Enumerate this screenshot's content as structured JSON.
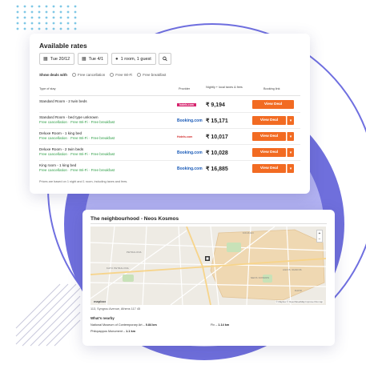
{
  "colors": {
    "accent": "#f26b22",
    "perk": "#2e9e46",
    "booking_blue": "#1a5bb8",
    "hotels_red": "#d32f2f",
    "decor_purple": "#6f6fe0"
  },
  "rates": {
    "title": "Available rates",
    "controls": [
      {
        "icon": "calendar-icon",
        "label": "Tue 20/12"
      },
      {
        "icon": "calendar-icon",
        "label": "Tue 4/1"
      },
      {
        "icon": "person-icon",
        "label": "1 room, 1 guest"
      },
      {
        "icon": "search-icon",
        "label": ""
      }
    ],
    "filters": {
      "label": "Show deals with",
      "options": [
        "Free cancellation",
        "Free Wi-Fi",
        "Free breakfast"
      ]
    },
    "columns": [
      "Type of stay",
      "Provider",
      "Nightly + local taxes & fees",
      "Booking link"
    ],
    "rows": [
      {
        "room": "Standard Room - 2 twin beds",
        "perks": "",
        "provider": "hotels.com",
        "price": "₹ 9,194",
        "deal": "View Deal",
        "dropdown": false
      },
      {
        "room": "Standard Room - bed type unknown",
        "perks": "Free cancellation · Free Wi-Fi · Free breakfast",
        "provider": "Booking.com",
        "price": "₹ 15,171",
        "deal": "View Deal",
        "dropdown": true
      },
      {
        "room": "Deluxe Room - 1 king bed",
        "perks": "Free cancellation · Free Wi-Fi · Free breakfast",
        "provider": "Hotels.com",
        "price": "₹ 10,017",
        "deal": "View Deal",
        "dropdown": true
      },
      {
        "room": "Deluxe Room - 2 twin beds",
        "perks": "Free cancellation · Free Wi-Fi · Free breakfast",
        "provider": "Booking.com",
        "price": "₹ 10,028",
        "deal": "View Deal",
        "dropdown": true
      },
      {
        "room": "King room - 1 king bed",
        "perks": "Free cancellation · Free Wi-Fi · Free breakfast",
        "provider": "Booking.com",
        "price": "₹ 16,885",
        "deal": "View Deal",
        "dropdown": true
      }
    ],
    "note": "Prices are based on 1 night and 1 room, including taxes and fees."
  },
  "neighbourhood": {
    "title": "The neighbourhood - Neos Kosmos",
    "map": {
      "labels": [
        "KOUKAKI",
        "NEOS KOSMOS",
        "AGIOS IOANNIS",
        "PETRALONA",
        "KATO PETRALONA",
        "DAFNI"
      ],
      "zoom_in": "+",
      "zoom_out": "−",
      "attribution": "© Mapbox © OpenStreetMap Improve this map",
      "logo": "mapbox"
    },
    "address": "113, Syngrou Avenue, Athens 117 45",
    "nearby_heading": "What's nearby",
    "nearby": [
      {
        "name": "National Museum of Contemporary Art",
        "dist": "0.84 km"
      },
      {
        "name": "Fix",
        "dist": "1.14 km"
      },
      {
        "name": "Philopappos Monument",
        "dist": "1.1 km"
      }
    ]
  }
}
